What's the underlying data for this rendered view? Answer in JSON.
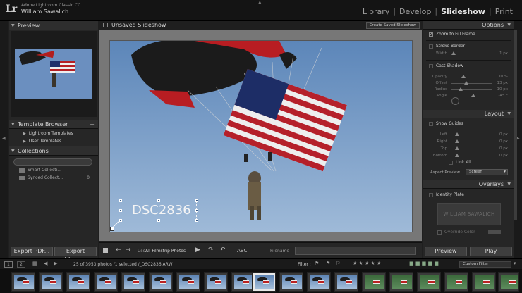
{
  "app": {
    "logo": "Lr",
    "app_name": "Adobe Lightroom Classic CC",
    "user_name": "William Sawalich"
  },
  "modules": [
    "Library",
    "Develop",
    "Slideshow",
    "Print"
  ],
  "left_panel": {
    "preview_title": "Preview",
    "template_browser_title": "Template Browser",
    "templates": [
      "Lightroom Templates",
      "User Templates"
    ],
    "collections_title": "Collections",
    "collections": [
      {
        "name": "Smart Collecti...",
        "count": ""
      },
      {
        "name": "Synced Collect...",
        "count": "0"
      }
    ],
    "export_pdf": "Export PDF...",
    "export_video": "Export Video..."
  },
  "center": {
    "title": "Unsaved Slideshow",
    "create_saved": "Create Saved Slideshow",
    "identity_text": "DSC2836"
  },
  "toolbar": {
    "use_label": "Use:",
    "use_value": "All Filmstrip Photos",
    "abc": "ABC",
    "filename_label": "Filename"
  },
  "right_panel": {
    "options_title": "Options",
    "zoom_to_fill": "Zoom to Fill Frame",
    "stroke_border": "Stroke Border",
    "width_label": "Width",
    "width_value": "1 px",
    "cast_shadow": "Cast Shadow",
    "shadow": [
      {
        "label": "Opacity",
        "value": "30 %"
      },
      {
        "label": "Offset",
        "value": "13 px"
      },
      {
        "label": "Radius",
        "value": "10 px"
      },
      {
        "label": "Angle",
        "value": "-45 °"
      }
    ],
    "layout_title": "Layout",
    "show_guides": "Show Guides",
    "guides": [
      {
        "label": "Left",
        "value": "0 px"
      },
      {
        "label": "Right",
        "value": "0 px"
      },
      {
        "label": "Top",
        "value": "0 px"
      },
      {
        "label": "Bottom",
        "value": "0 px"
      }
    ],
    "link_all": "Link All",
    "aspect_label": "Aspect Preview",
    "aspect_value": "Screen",
    "overlays_title": "Overlays",
    "identity_plate": "Identity Plate",
    "identity_plate_text": "WILLIAM SAWALICH",
    "override_color": "Override Color",
    "preview_btn": "Preview",
    "play_btn": "Play"
  },
  "filmbar": {
    "page1": "1",
    "page2": "2",
    "info": "25 of 3953 photos /1 selected /_DSC2836.ARW",
    "filter_label": "Filter :",
    "custom_filter": "Custom Filter"
  },
  "colors": {
    "background": "#1f1f1f",
    "panel": "#262626",
    "stage": "#777777",
    "active_text": "#e6e6e6"
  }
}
